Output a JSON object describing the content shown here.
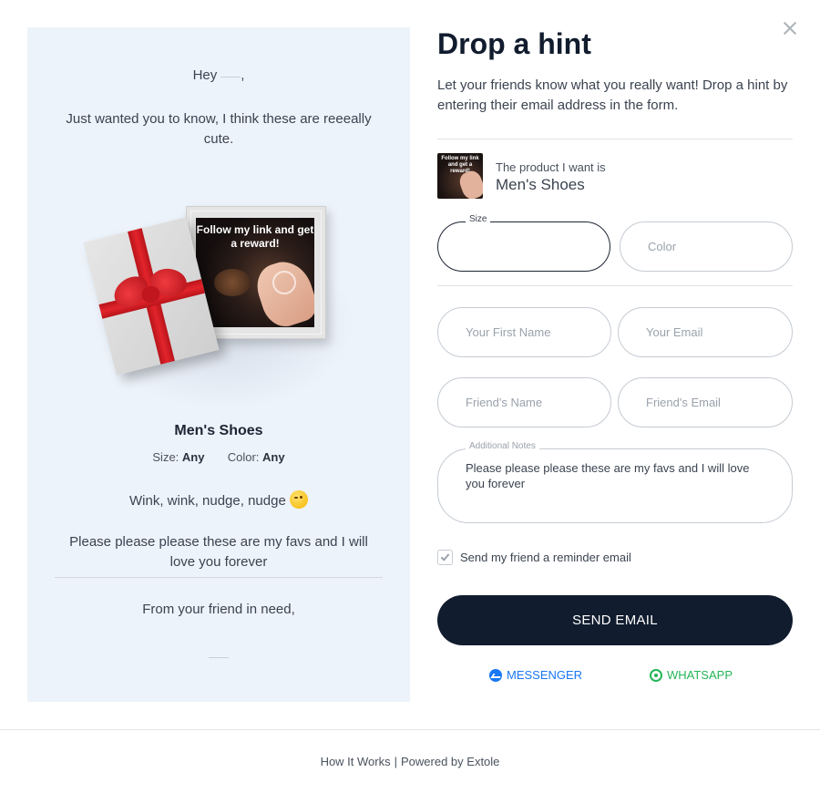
{
  "preview": {
    "greeting": "Hey",
    "greeting_comma": ",",
    "intro": "Just wanted you to know, I think these are reeeally cute.",
    "image_caption": "Follow my link and get a reward!",
    "product_name": "Men's Shoes",
    "size_label": "Size:",
    "size_value": "Any",
    "color_label": "Color:",
    "color_value": "Any",
    "wink_text": "Wink, wink, nudge, nudge",
    "note": "Please please please these are my favs and I will love you forever",
    "from": "From your friend in need,"
  },
  "form": {
    "title": "Drop a hint",
    "subtitle": "Let your friends know what you really want! Drop a hint by entering their email address in the form.",
    "product_label": "The product I want is",
    "product_value": "Men's Shoes",
    "thumb_caption": "Follow my link and get a reward!",
    "size_label": "Size",
    "size_value": "",
    "color_placeholder": "Color",
    "first_name_placeholder": "Your First Name",
    "your_email_placeholder": "Your Email",
    "friend_name_placeholder": "Friend's Name",
    "friend_email_placeholder": "Friend's Email",
    "notes_label": "Additional Notes",
    "notes_value": "Please please please these are my favs and I will love you forever",
    "reminder_label": "Send my friend a reminder email",
    "reminder_checked": true,
    "send_button": "SEND EMAIL",
    "messenger_label": "MESSENGER",
    "whatsapp_label": "WHATSAPP"
  },
  "footer": {
    "how_it_works": "How It Works",
    "separator": "|",
    "powered_by": "Powered by Extole"
  },
  "colors": {
    "primary": "#111c2e",
    "preview_bg": "#edf3fb",
    "messenger": "#1877f2",
    "whatsapp": "#25b559"
  },
  "icons": [
    "close-icon",
    "checkmark-icon",
    "messenger-icon",
    "whatsapp-icon",
    "wink-emoji-icon"
  ]
}
